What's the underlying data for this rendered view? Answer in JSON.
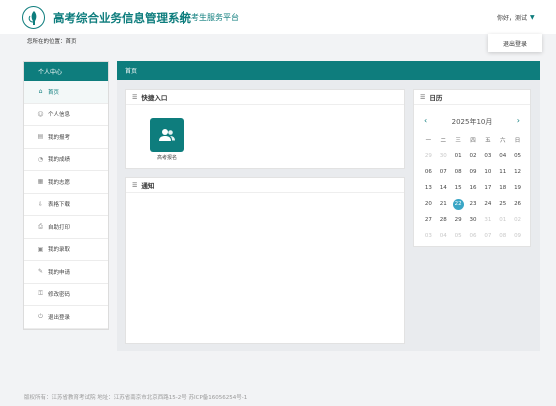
{
  "header": {
    "system_title": "高考综合业务信息管理系统",
    "subtitle": "考生服务平台",
    "greeting": "你好，测试",
    "logout_label": "退出登录"
  },
  "breadcrumb": {
    "text": "您所在的位置：首页"
  },
  "sidebar": {
    "title": "个人中心",
    "items": [
      {
        "label": "首页",
        "icon": "home-icon",
        "active": true
      },
      {
        "label": "个人信息",
        "icon": "user-icon"
      },
      {
        "label": "我的报考",
        "icon": "id-card-icon"
      },
      {
        "label": "我的成绩",
        "icon": "chart-icon"
      },
      {
        "label": "我的志愿",
        "icon": "list-icon"
      },
      {
        "label": "表格下载",
        "icon": "download-icon"
      },
      {
        "label": "自助打印",
        "icon": "printer-icon"
      },
      {
        "label": "我的录取",
        "icon": "calendar-icon"
      },
      {
        "label": "我的申请",
        "icon": "edit-icon"
      },
      {
        "label": "修改密码",
        "icon": "lock-icon"
      },
      {
        "label": "退出登录",
        "icon": "logout-icon"
      }
    ]
  },
  "main": {
    "title": "首页",
    "quick_entry": {
      "title": "快捷入口",
      "items": [
        {
          "label": "高考报名",
          "icon": "users-icon"
        }
      ]
    },
    "notice": {
      "title": "通知"
    },
    "calendar": {
      "title": "日历",
      "month_label": "2025年10月",
      "weekdays": [
        "一",
        "二",
        "三",
        "四",
        "五",
        "六",
        "日"
      ],
      "days": [
        {
          "d": "29",
          "other": true
        },
        {
          "d": "30",
          "other": true
        },
        {
          "d": "01"
        },
        {
          "d": "02"
        },
        {
          "d": "03"
        },
        {
          "d": "04"
        },
        {
          "d": "05"
        },
        {
          "d": "06"
        },
        {
          "d": "07"
        },
        {
          "d": "08"
        },
        {
          "d": "09"
        },
        {
          "d": "10"
        },
        {
          "d": "11"
        },
        {
          "d": "12"
        },
        {
          "d": "13"
        },
        {
          "d": "14"
        },
        {
          "d": "15"
        },
        {
          "d": "16"
        },
        {
          "d": "17"
        },
        {
          "d": "18"
        },
        {
          "d": "19"
        },
        {
          "d": "20"
        },
        {
          "d": "21"
        },
        {
          "d": "22",
          "today": true
        },
        {
          "d": "23"
        },
        {
          "d": "24"
        },
        {
          "d": "25"
        },
        {
          "d": "26"
        },
        {
          "d": "27"
        },
        {
          "d": "28"
        },
        {
          "d": "29"
        },
        {
          "d": "30"
        },
        {
          "d": "31",
          "other": true
        },
        {
          "d": "01",
          "other": true
        },
        {
          "d": "02",
          "other": true
        },
        {
          "d": "03",
          "other": true
        },
        {
          "d": "04",
          "other": true
        },
        {
          "d": "05",
          "other": true
        },
        {
          "d": "06",
          "other": true
        },
        {
          "d": "07",
          "other": true
        },
        {
          "d": "08",
          "other": true
        },
        {
          "d": "09",
          "other": true
        }
      ]
    }
  },
  "footer": {
    "text": "版权所有：江苏省教育考试院 地址：江苏省南京市北京西路15-2号 苏ICP备16056254号-1"
  },
  "colors": {
    "primary": "#0e7d7d",
    "today": "#3aa6c6"
  }
}
